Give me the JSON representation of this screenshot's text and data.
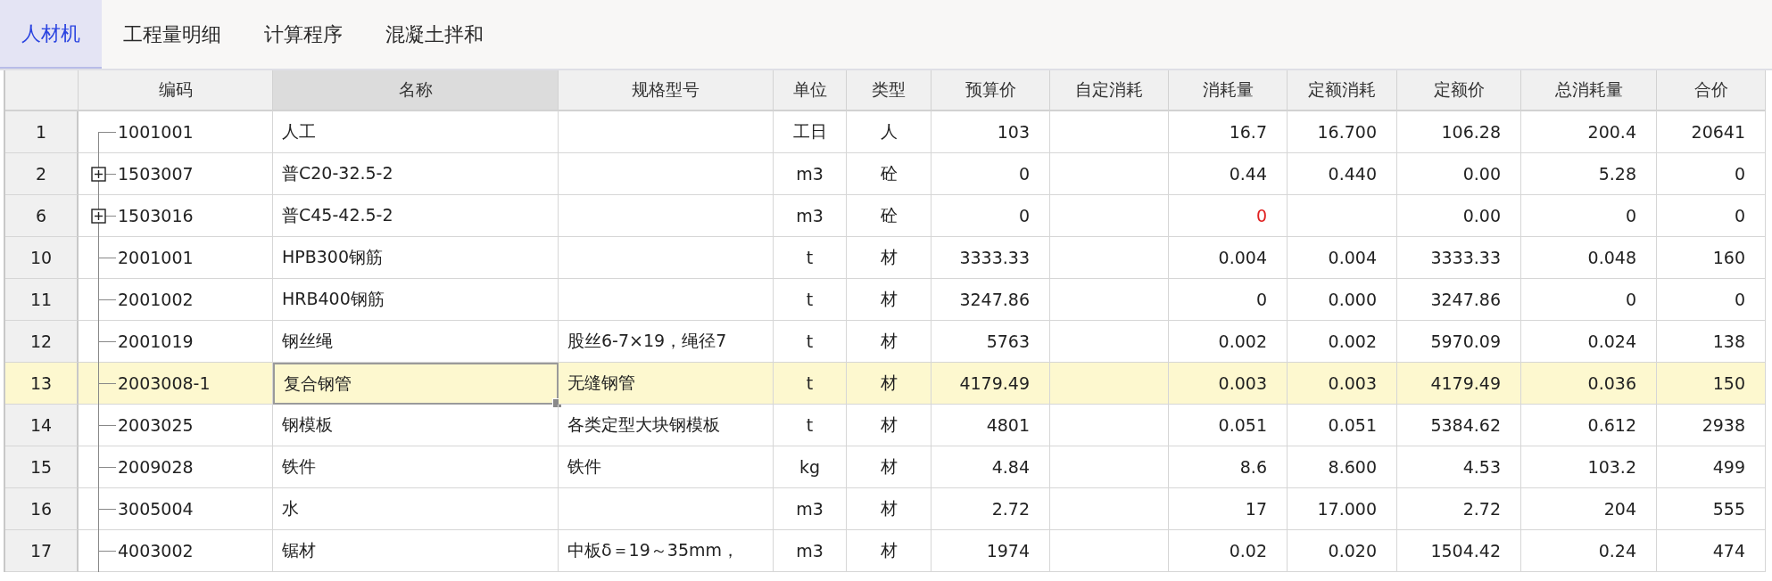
{
  "tabs": [
    {
      "label": "人材机",
      "selected": true
    },
    {
      "label": "工程量明细",
      "selected": false
    },
    {
      "label": "计算程序",
      "selected": false
    },
    {
      "label": "混凝土拌和",
      "selected": false
    }
  ],
  "table": {
    "columns": [
      {
        "label": "编码",
        "selected": false
      },
      {
        "label": "名称",
        "selected": true
      },
      {
        "label": "规格型号",
        "selected": false
      },
      {
        "label": "单位",
        "selected": false
      },
      {
        "label": "类型",
        "selected": false
      },
      {
        "label": "预算价",
        "selected": false
      },
      {
        "label": "自定消耗",
        "selected": false
      },
      {
        "label": "消耗量",
        "selected": false
      },
      {
        "label": "定额消耗",
        "selected": false
      },
      {
        "label": "定额价",
        "selected": false
      },
      {
        "label": "总消耗量",
        "selected": false
      },
      {
        "label": "合价",
        "selected": false
      }
    ],
    "rows": [
      {
        "number": "1",
        "code": "1001001",
        "expandable": false,
        "name": "人工",
        "unit": "工日",
        "type": "人",
        "price": "103",
        "consumption": "16.7",
        "consumption_warning": false,
        "quota_consumption": "16.700",
        "quota_price": "106.28",
        "total_consumption": "200.4",
        "total_price": "20641",
        "selected": false
      },
      {
        "number": "2",
        "code": "1503007",
        "expandable": true,
        "name": "普C20-32.5-2",
        "unit": "m3",
        "type": "砼",
        "price": "0",
        "consumption": "0.44",
        "consumption_warning": false,
        "quota_consumption": "0.440",
        "quota_price": "0.00",
        "total_consumption": "5.28",
        "total_price": "0",
        "selected": false
      },
      {
        "number": "6",
        "code": "1503016",
        "expandable": true,
        "name": "普C45-42.5-2",
        "unit": "m3",
        "type": "砼",
        "price": "0",
        "consumption": "0",
        "consumption_warning": true,
        "quota_price": "0.00",
        "total_consumption": "0",
        "total_price": "0",
        "selected": false
      },
      {
        "number": "10",
        "code": "2001001",
        "expandable": false,
        "name": "HPB300钢筋",
        "unit": "t",
        "type": "材",
        "price": "3333.33",
        "consumption": "0.004",
        "consumption_warning": false,
        "quota_consumption": "0.004",
        "quota_price": "3333.33",
        "total_consumption": "0.048",
        "total_price": "160",
        "selected": false
      },
      {
        "number": "11",
        "code": "2001002",
        "expandable": false,
        "name": "HRB400钢筋",
        "unit": "t",
        "type": "材",
        "price": "3247.86",
        "consumption": "0",
        "consumption_warning": false,
        "quota_consumption": "0.000",
        "quota_price": "3247.86",
        "total_consumption": "0",
        "total_price": "0",
        "selected": false
      },
      {
        "number": "12",
        "code": "2001019",
        "expandable": false,
        "name": "钢丝绳",
        "spec": "股丝6-7×19，绳径7",
        "unit": "t",
        "type": "材",
        "price": "5763",
        "consumption": "0.002",
        "consumption_warning": false,
        "quota_consumption": "0.002",
        "quota_price": "5970.09",
        "total_consumption": "0.024",
        "total_price": "138",
        "selected": false
      },
      {
        "number": "13",
        "code": "2003008-1",
        "expandable": false,
        "name": "复合钢管",
        "spec": "无缝钢管",
        "unit": "t",
        "type": "材",
        "price": "4179.49",
        "consumption": "0.003",
        "consumption_warning": false,
        "quota_consumption": "0.003",
        "quota_price": "4179.49",
        "total_consumption": "0.036",
        "total_price": "150",
        "selected": true
      },
      {
        "number": "14",
        "code": "2003025",
        "expandable": false,
        "name": "钢模板",
        "spec": "各类定型大块钢模板",
        "unit": "t",
        "type": "材",
        "price": "4801",
        "consumption": "0.051",
        "consumption_warning": false,
        "quota_consumption": "0.051",
        "quota_price": "5384.62",
        "total_consumption": "0.612",
        "total_price": "2938",
        "selected": false
      },
      {
        "number": "15",
        "code": "2009028",
        "expandable": false,
        "name": "铁件",
        "spec": "铁件",
        "unit": "kg",
        "type": "材",
        "price": "4.84",
        "consumption": "8.6",
        "consumption_warning": false,
        "quota_consumption": "8.600",
        "quota_price": "4.53",
        "total_consumption": "103.2",
        "total_price": "499",
        "selected": false
      },
      {
        "number": "16",
        "code": "3005004",
        "expandable": false,
        "name": "水",
        "unit": "m3",
        "type": "材",
        "price": "2.72",
        "consumption": "17",
        "consumption_warning": false,
        "quota_consumption": "17.000",
        "quota_price": "2.72",
        "total_consumption": "204",
        "total_price": "555",
        "selected": false
      },
      {
        "number": "17",
        "code": "4003002",
        "expandable": false,
        "name": "锯材",
        "spec": "中板δ＝19～35mm，",
        "unit": "m3",
        "type": "材",
        "price": "1974",
        "consumption": "0.02",
        "consumption_warning": false,
        "quota_consumption": "0.020",
        "quota_price": "1504.42",
        "total_consumption": "0.24",
        "total_price": "474",
        "selected": false
      }
    ]
  }
}
